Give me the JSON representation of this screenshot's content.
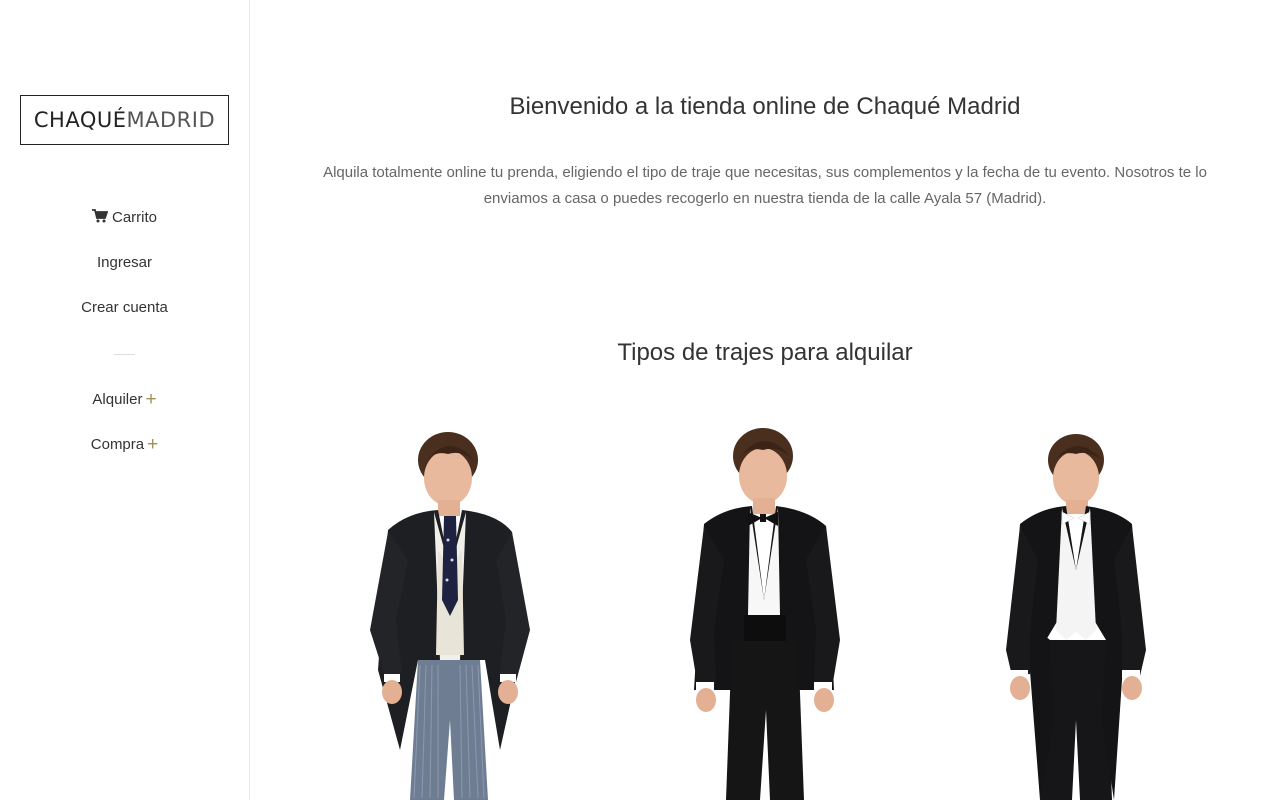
{
  "logo": {
    "part1": "CHAQUÉ ",
    "part2": "MADRID"
  },
  "sidebar": {
    "cart_label": "Carrito",
    "login_label": "Ingresar",
    "register_label": "Crear cuenta",
    "menus": [
      {
        "label": "Alquiler",
        "expand": "+"
      },
      {
        "label": "Compra",
        "expand": "+"
      }
    ]
  },
  "main": {
    "welcome_title": "Bienvenido a la tienda online de Chaqué Madrid",
    "intro_text": "Alquila totalmente online tu prenda, eligiendo el tipo de traje que necesitas, sus complementos y la fecha de tu evento. Nosotros te lo enviamos a casa o puedes recogerlo en nuestra tienda de la calle Ayala 57 (Madrid).",
    "section_title": "Tipos de trajes para alquilar"
  },
  "colors": {
    "accent": "#a38f5a",
    "text": "#333333",
    "muted": "#666666"
  },
  "icons": [
    "cart-icon",
    "plus-icon"
  ]
}
